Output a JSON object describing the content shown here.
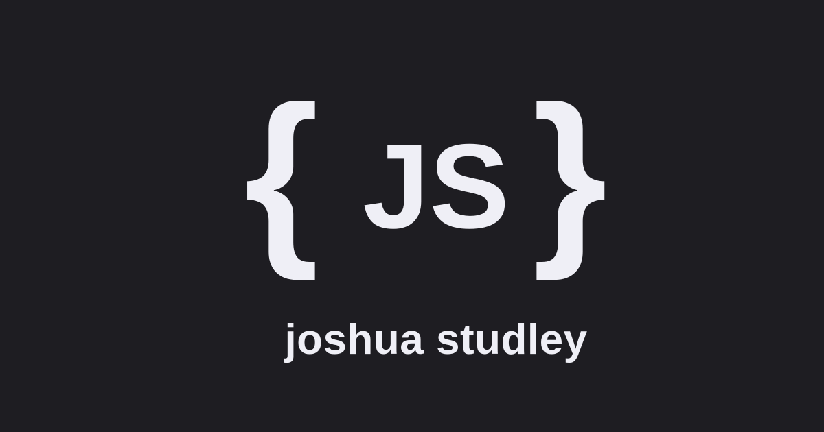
{
  "logo": {
    "brace_left": "{",
    "letters": "JS",
    "brace_right": "}"
  },
  "name": "joshua studley",
  "colors": {
    "background": "#1e1d22",
    "foreground": "#efeff6"
  }
}
